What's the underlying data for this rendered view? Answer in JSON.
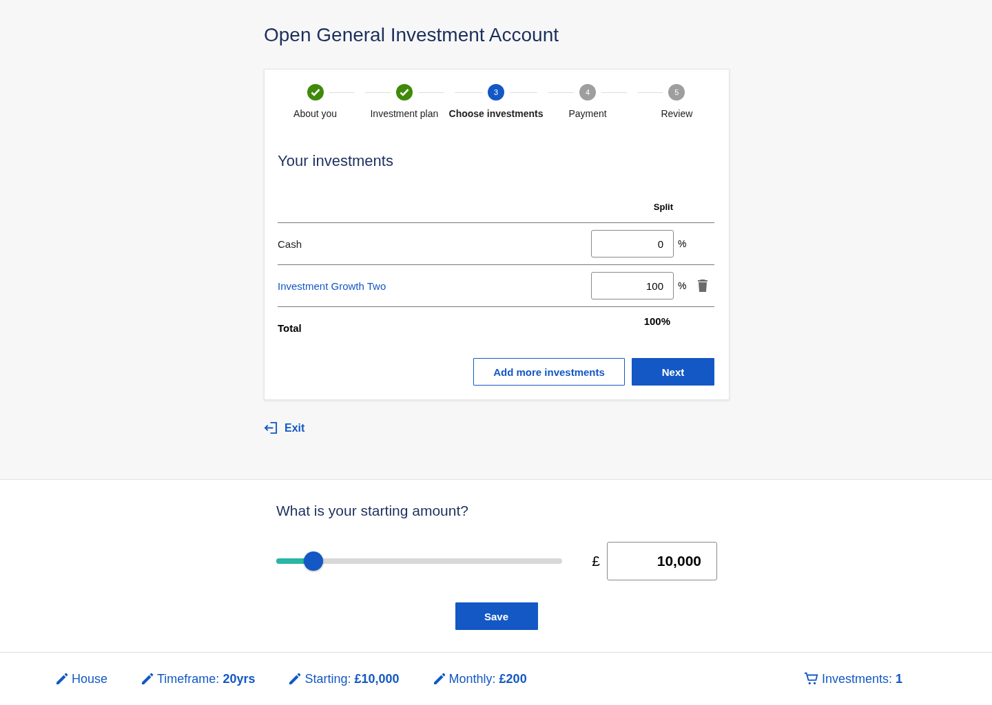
{
  "page_title": "Open General Investment Account",
  "steps": [
    {
      "label": "About you",
      "kind": "done"
    },
    {
      "label": "Investment plan",
      "kind": "done"
    },
    {
      "label": "Choose investments",
      "kind": "current",
      "number": "3"
    },
    {
      "label": "Payment",
      "kind": "todo",
      "number": "4"
    },
    {
      "label": "Review",
      "kind": "todo",
      "number": "5"
    }
  ],
  "section_title": "Your investments",
  "table": {
    "split_header": "Split",
    "rows": [
      {
        "name": "Cash",
        "kind": "plain",
        "value": "0",
        "unit": "%",
        "deletable": false
      },
      {
        "name": "Investment Growth Two",
        "kind": "link",
        "value": "100",
        "unit": "%",
        "deletable": true
      }
    ],
    "total_label": "Total",
    "total_value": "100%"
  },
  "buttons": {
    "secondary": "Add more investments",
    "primary": "Next"
  },
  "exit_link": "Exit",
  "amount": {
    "question": "What is your starting amount?",
    "level": 0.13,
    "currency": "£",
    "value": "10,000",
    "save": "Save"
  },
  "footer": {
    "items": [
      {
        "text": "House"
      },
      {
        "text": "Timeframe: **20yrs**"
      },
      {
        "text": "Starting: **£10,000**"
      },
      {
        "text": "Monthly: **£200**"
      }
    ],
    "cart": "Investments: **1**"
  }
}
